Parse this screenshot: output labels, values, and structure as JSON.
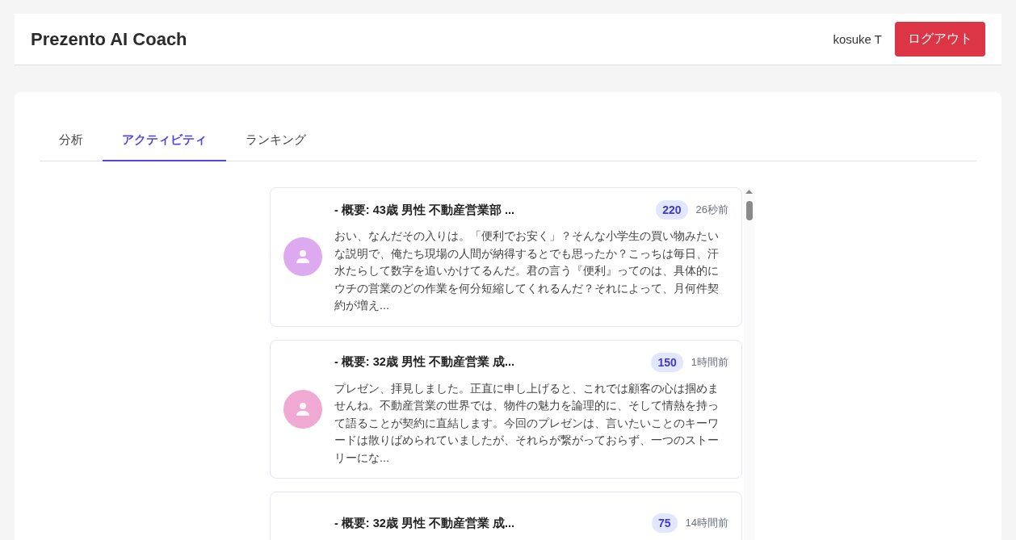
{
  "header": {
    "title": "Prezento AI Coach",
    "user": "kosuke T",
    "logout": "ログアウト"
  },
  "tabs": [
    {
      "label": "分析",
      "selected": false
    },
    {
      "label": "アクティビティ",
      "selected": true
    },
    {
      "label": "ランキング",
      "selected": false
    }
  ],
  "activities": [
    {
      "title": "- 概要: 43歳 男性 不動産営業部 ...",
      "score": "220",
      "time": "26秒前",
      "color": "#dda9ef",
      "message": "おい、なんだその入りは。「便利でお安く」？そんな小学生の買い物みたいな説明で、俺たち現場の人間が納得するとでも思ったか？こっちは毎日、汗水たらして数字を追いかけてるんだ。君の言う『便利』ってのは、具体的にウチの営業のどの作業を何分短縮してくれるんだ？それによって、月何件契約が増え..."
    },
    {
      "title": "- 概要: 32歳 男性 不動産営業 成...",
      "score": "150",
      "time": "1時間前",
      "color": "#efa9d3",
      "message": "プレゼン、拝見しました。正直に申し上げると、これでは顧客の心は掴めませんね。不動産営業の世界では、物件の魅力を論理的に、そして情熱を持って語ることが契約に直結します。今回のプレゼンは、言いたいことのキーワードは散りばめられていましたが、それらが繋がっておらず、一つのストーリーにな..."
    },
    {
      "title": "- 概要: 32歳 男性 不動産営業 成...",
      "score": "75",
      "time": "14時間前"
    }
  ]
}
